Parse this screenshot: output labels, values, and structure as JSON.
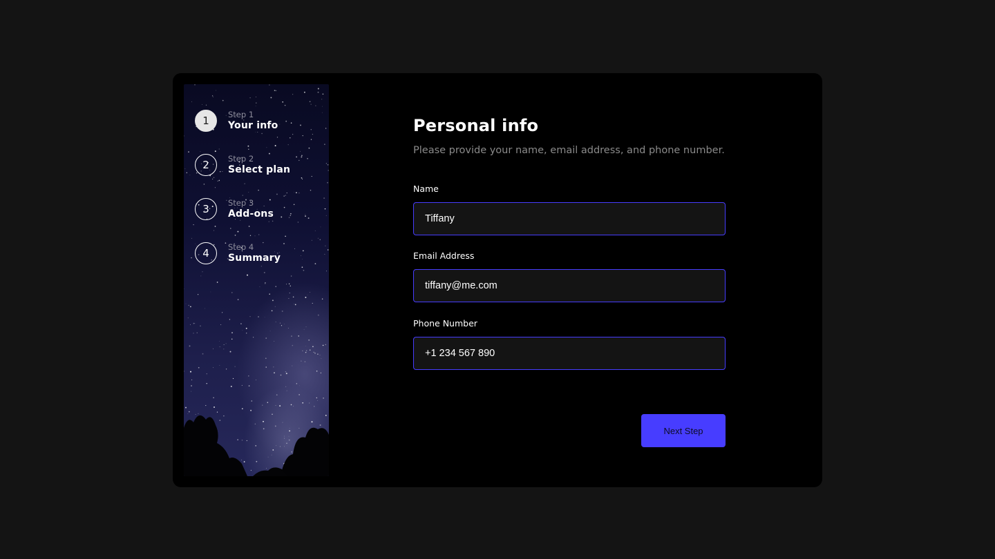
{
  "steps": [
    {
      "number": "1",
      "label": "Step 1",
      "title": "Your info",
      "active": true
    },
    {
      "number": "2",
      "label": "Step 2",
      "title": "Select plan",
      "active": false
    },
    {
      "number": "3",
      "label": "Step 3",
      "title": "Add-ons",
      "active": false
    },
    {
      "number": "4",
      "label": "Step 4",
      "title": "Summary",
      "active": false
    }
  ],
  "form": {
    "title": "Personal info",
    "subtitle": "Please provide your name, email address, and phone number.",
    "name": {
      "label": "Name",
      "value": "Tiffany"
    },
    "email": {
      "label": "Email Address",
      "value": "tiffany@me.com"
    },
    "phone": {
      "label": "Phone Number",
      "value": "+1 234 567 890"
    },
    "next_label": "Next Step"
  },
  "colors": {
    "page_background": "#141414",
    "card_background": "#000000",
    "accent": "#473dff",
    "input_background": "#141414",
    "muted_text": "#8a8a8a"
  },
  "icons": {
    "sidebar_background": "night-sky-image"
  }
}
